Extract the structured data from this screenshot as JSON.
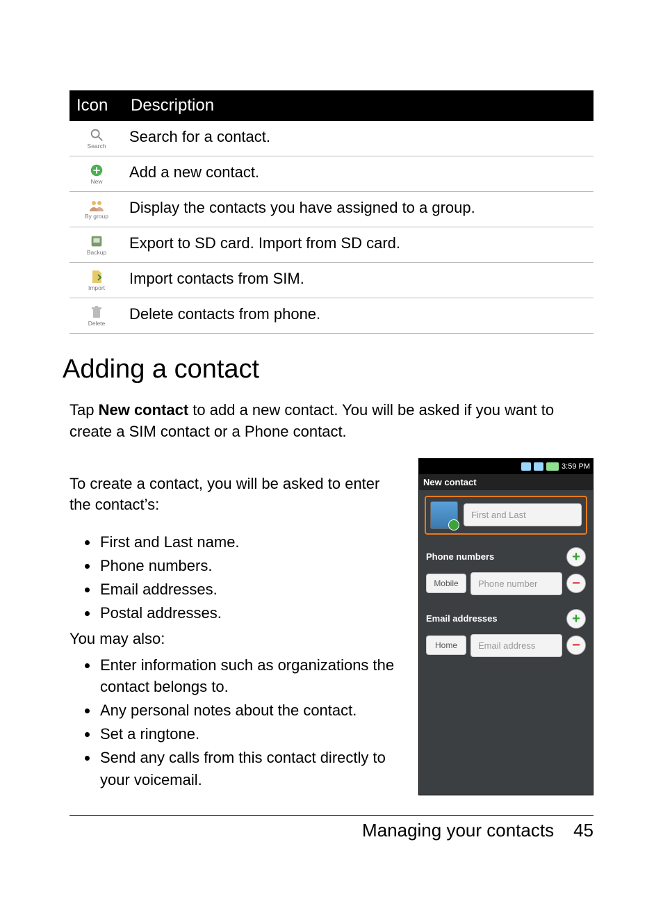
{
  "table": {
    "headers": {
      "icon": "Icon",
      "desc": "Description"
    },
    "rows": [
      {
        "label": "Search",
        "desc": "Search for a contact."
      },
      {
        "label": "New",
        "desc": "Add a new contact."
      },
      {
        "label": "By group",
        "desc": "Display the contacts you have assigned to a group."
      },
      {
        "label": "Backup",
        "desc": "Export to SD card. Import from SD card."
      },
      {
        "label": "Import",
        "desc": "Import contacts from SIM."
      },
      {
        "label": "Delete",
        "desc": "Delete contacts from phone."
      }
    ]
  },
  "heading": "Adding a contact",
  "intro": {
    "pre": "Tap ",
    "bold": "New contact",
    "post": " to add a new contact. You will be asked if you want to create a SIM contact or a Phone contact."
  },
  "para2": "To create a contact, you will be asked to enter the contact’s:",
  "fields": [
    "First and Last name.",
    "Phone numbers.",
    "Email addresses.",
    "Postal addresses."
  ],
  "also_lead": "You may also:",
  "also": [
    "Enter information such as organizations the contact belongs to.",
    "Any personal notes about the contact.",
    "Set a ringtone.",
    "Send any calls from this contact directly to your voicemail."
  ],
  "phone": {
    "time": "3:59 PM",
    "title": "New contact",
    "name_placeholder": "First and Last",
    "phones_label": "Phone numbers",
    "phone_type": "Mobile",
    "phone_placeholder": "Phone number",
    "emails_label": "Email addresses",
    "email_type": "Home",
    "email_placeholder": "Email address"
  },
  "footer": {
    "title": "Managing your contacts",
    "page": "45"
  }
}
